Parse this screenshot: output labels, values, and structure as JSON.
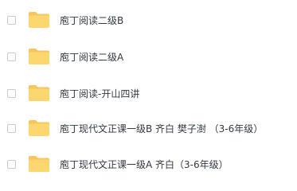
{
  "colors": {
    "folder_back": "#f7c55a",
    "folder_front": "#fcd66e",
    "checkbox_border": "#c9ccd1",
    "text": "#333a44"
  },
  "files": [
    {
      "name": "庖丁阅读二级B",
      "icon": "folder-icon"
    },
    {
      "name": "庖丁阅读二级A",
      "icon": "folder-icon"
    },
    {
      "name": "庖丁阅读-开山四讲",
      "icon": "folder-icon"
    },
    {
      "name": "庖丁现代文正课一级B 齐白 樊子澍 （3-6年级）",
      "icon": "folder-icon"
    },
    {
      "name": "庖丁现代文正课一级A 齐白（3-6年级）",
      "icon": "folder-icon"
    }
  ]
}
